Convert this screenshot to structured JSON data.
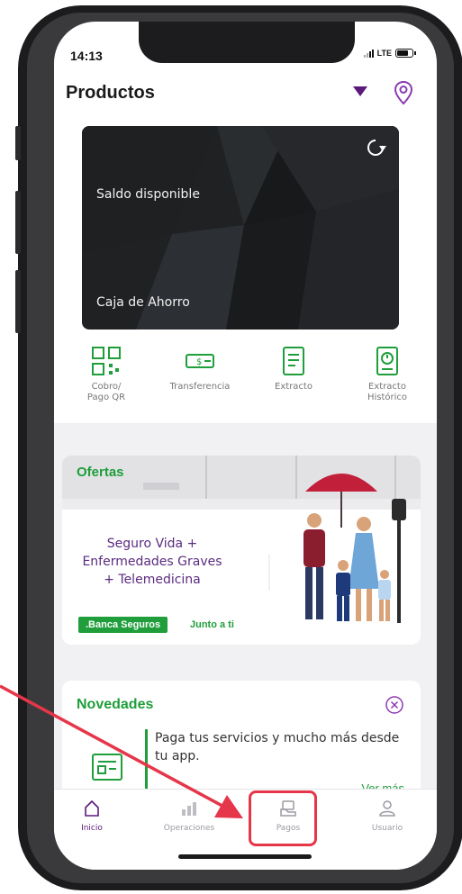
{
  "status_bar": {
    "time": "14:13",
    "network": "LTE"
  },
  "header": {
    "title": "Productos"
  },
  "card": {
    "balance_label": "Saldo disponible",
    "account_type": "Caja de Ahorro"
  },
  "quick_actions": [
    {
      "label": "Cobro/\nPago QR",
      "icon": "qr-code-icon"
    },
    {
      "label": "Transferencia",
      "icon": "money-transfer-icon"
    },
    {
      "label": "Extracto",
      "icon": "statement-icon"
    },
    {
      "label": "Extracto\nHistórico",
      "icon": "history-statement-icon"
    }
  ],
  "offers": {
    "title": "Ofertas",
    "line1": "Seguro Vida +",
    "line2": "Enfermedades Graves",
    "line3": "+ Telemedicina",
    "badge": ".Banca Seguros",
    "tagline": "Junto a ti"
  },
  "news": {
    "title": "Novedades",
    "text": "Paga tus servicios y mucho más desde tu app.",
    "more": "Ver más"
  },
  "tabbar": {
    "items": [
      {
        "label": "Inicio",
        "icon": "home-icon"
      },
      {
        "label": "Operaciones",
        "icon": "chart-icon"
      },
      {
        "label": "Pagos",
        "icon": "payments-icon"
      },
      {
        "label": "Usuario",
        "icon": "user-icon"
      }
    ]
  },
  "colors": {
    "brand_green": "#1f9e3b",
    "brand_purple": "#5b1a7a",
    "highlight_red": "#e5364a"
  }
}
